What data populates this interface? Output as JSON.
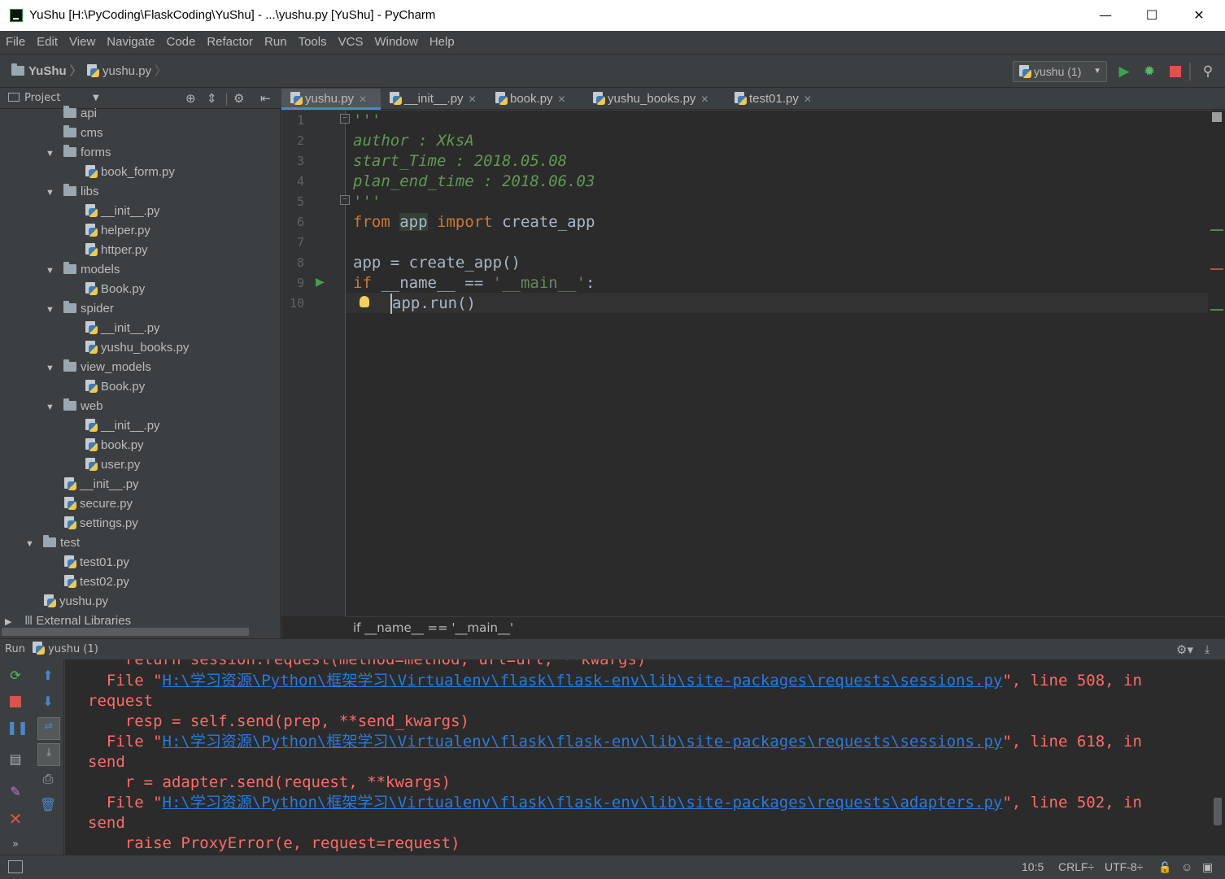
{
  "window": {
    "title": "YuShu [H:\\PyCoding\\FlaskCoding\\YuShu] - ...\\yushu.py [YuShu] - PyCharm",
    "minimize": "—",
    "maximize": "☐",
    "close": "✕"
  },
  "menu": [
    "File",
    "Edit",
    "View",
    "Navigate",
    "Code",
    "Refactor",
    "Run",
    "Tools",
    "VCS",
    "Window",
    "Help"
  ],
  "nav": {
    "project": "YuShu",
    "file": "yushu.py",
    "run_config": "yushu (1)"
  },
  "project_panel": {
    "label": "Project",
    "tree": [
      {
        "name": "api",
        "type": "folder",
        "level": 3,
        "expanded": false
      },
      {
        "name": "cms",
        "type": "folder",
        "level": 3,
        "expanded": false
      },
      {
        "name": "forms",
        "type": "folder",
        "level": 3,
        "expanded": true
      },
      {
        "name": "book_form.py",
        "type": "py",
        "level": 4
      },
      {
        "name": "libs",
        "type": "folder",
        "level": 3,
        "expanded": true
      },
      {
        "name": "__init__.py",
        "type": "py",
        "level": 4
      },
      {
        "name": "helper.py",
        "type": "py",
        "level": 4
      },
      {
        "name": "httper.py",
        "type": "py",
        "level": 4
      },
      {
        "name": "models",
        "type": "folder",
        "level": 3,
        "expanded": true
      },
      {
        "name": "Book.py",
        "type": "py",
        "level": 4
      },
      {
        "name": "spider",
        "type": "folder",
        "level": 3,
        "expanded": true
      },
      {
        "name": "__init__.py",
        "type": "py",
        "level": 4
      },
      {
        "name": "yushu_books.py",
        "type": "py",
        "level": 4
      },
      {
        "name": "view_models",
        "type": "folder",
        "level": 3,
        "expanded": true
      },
      {
        "name": "Book.py",
        "type": "py",
        "level": 4
      },
      {
        "name": "web",
        "type": "folder",
        "level": 3,
        "expanded": true
      },
      {
        "name": "__init__.py",
        "type": "py",
        "level": 4
      },
      {
        "name": "book.py",
        "type": "py",
        "level": 4
      },
      {
        "name": "user.py",
        "type": "py",
        "level": 4
      },
      {
        "name": "__init__.py",
        "type": "py",
        "level": 3
      },
      {
        "name": "secure.py",
        "type": "py",
        "level": 3
      },
      {
        "name": "settings.py",
        "type": "py",
        "level": 3
      },
      {
        "name": "test",
        "type": "folder",
        "level": 2,
        "expanded": true
      },
      {
        "name": "test01.py",
        "type": "py",
        "level": 3
      },
      {
        "name": "test02.py",
        "type": "py",
        "level": 3
      },
      {
        "name": "yushu.py",
        "type": "py",
        "level": 2
      },
      {
        "name": "External Libraries",
        "type": "lib",
        "level": 0,
        "expanded": false
      }
    ]
  },
  "tabs": [
    {
      "label": "yushu.py",
      "active": true
    },
    {
      "label": "__init__.py",
      "active": false
    },
    {
      "label": "book.py",
      "active": false
    },
    {
      "label": "yushu_books.py",
      "active": false
    },
    {
      "label": "test01.py",
      "active": false
    }
  ],
  "editor": {
    "line_numbers": [
      "1",
      "2",
      "3",
      "4",
      "5",
      "6",
      "7",
      "8",
      "9",
      "10"
    ],
    "l1": "'''",
    "l2": "author : XksA",
    "l3": "start_Time : 2018.05.08",
    "l4": "plan_end_time : 2018.06.03",
    "l5": "'''",
    "l6_kw1": "from",
    "l6_mod": "app",
    "l6_kw2": "import",
    "l6_name": "create_app",
    "l8": "app = create_app()",
    "l9_kw": "if",
    "l9_mid": "__name__ == ",
    "l9_str": "'__main__'",
    "l9_end": ":",
    "l10": "app.run()",
    "breadcrumb": "if __name__ == '__main__'"
  },
  "run_panel": {
    "label": "Run",
    "config": "yushu (1)",
    "console": {
      "l0": "    return session.request(method=method, url=url, **kwargs)",
      "f1_pre": "  File \"",
      "f1_link": "H:\\学习资源\\Python\\框架学习\\Virtualenv\\flask\\flask-env\\lib\\site-packages\\requests\\sessions.py",
      "f1_post": "\", line 508, in",
      "l2": "request",
      "l3": "    resp = self.send(prep, **send_kwargs)",
      "f2_pre": "  File \"",
      "f2_link": "H:\\学习资源\\Python\\框架学习\\Virtualenv\\flask\\flask-env\\lib\\site-packages\\requests\\sessions.py",
      "f2_post": "\", line 618, in",
      "l5": "send",
      "l6": "    r = adapter.send(request, **kwargs)",
      "f3_pre": "  File \"",
      "f3_link": "H:\\学习资源\\Python\\框架学习\\Virtualenv\\flask\\flask-env\\lib\\site-packages\\requests\\adapters.py",
      "f3_post": "\", line 502, in",
      "l8": "send",
      "l9": "    raise ProxyError(e, request=request)"
    }
  },
  "status": {
    "position": "10:5",
    "line_sep": "CRLF÷",
    "encoding": "UTF-8÷"
  },
  "colors": {
    "bg": "#3c3f41",
    "editor_bg": "#2b2b2b",
    "keyword": "#cc7832",
    "docstring": "#629755",
    "error_text": "#ff6b68",
    "link": "#287bde"
  }
}
